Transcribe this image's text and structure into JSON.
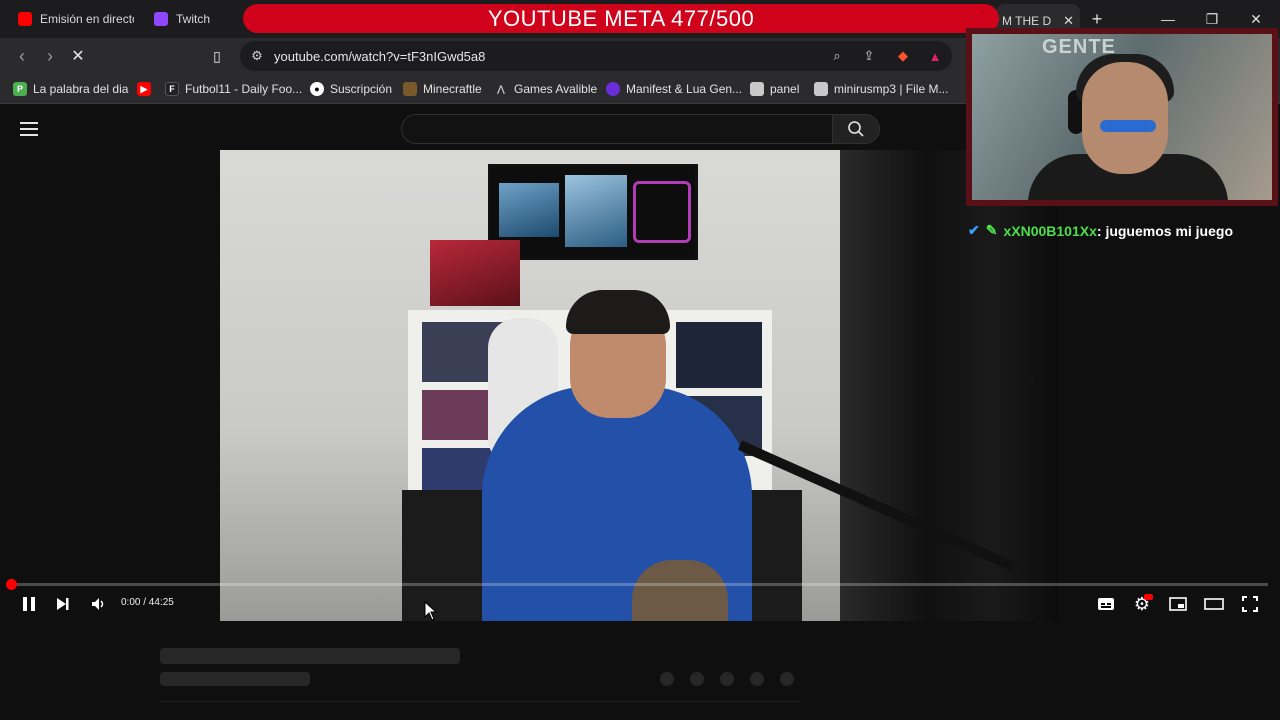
{
  "browser": {
    "tabs": [
      {
        "label": "Emisión en directo",
        "favicon": "youtube-icon",
        "color": "#ff0000"
      },
      {
        "label": "Twitch",
        "favicon": "twitch-icon",
        "color": "#9146ff"
      },
      {
        "label": "M THE D",
        "favicon": "",
        "active": true
      }
    ],
    "url": "youtube.com/watch?v=tF3nIGwd5a8",
    "window_controls": [
      "minimize-icon",
      "restore-icon",
      "close-icon"
    ]
  },
  "overlay": {
    "banner_text": "YOUTUBE META 477/500",
    "banner_color": "#d0021b"
  },
  "bookmarks": [
    {
      "label": "La palabra del dia",
      "icon": "p-icon",
      "color": "#4caf50"
    },
    {
      "label": "",
      "icon": "youtube-icon",
      "color": "#ff0000"
    },
    {
      "label": "Futbol11 - Daily Foo...",
      "icon": "futbol11-icon",
      "color": "#222222"
    },
    {
      "label": "Suscripción",
      "icon": "circle-icon",
      "color": "#ffffff"
    },
    {
      "label": "Minecraftle",
      "icon": "minecraft-icon",
      "color": "#7a5a2a"
    },
    {
      "label": "Games Avalible",
      "icon": "games-icon",
      "color": "#bbbbbb"
    },
    {
      "label": "Manifest & Lua Gen...",
      "icon": "manifest-icon",
      "color": "#6a2ed8"
    },
    {
      "label": "panel",
      "icon": "panel-icon",
      "color": "#c9c9c9"
    },
    {
      "label": "minirusmp3 | File M...",
      "icon": "file-icon",
      "color": "#c9c9c9"
    }
  ],
  "player": {
    "time": "0:00 / 44:25",
    "progress": 0.0,
    "state": "playing"
  },
  "chat": {
    "username": "xXN00B101Xx",
    "message": "juguemos mi juego",
    "badges": [
      "verified-icon",
      "moderator-icon"
    ]
  },
  "colors": {
    "yt_bg": "#0f0f0f",
    "progress": "#ff0000",
    "chat_user": "#4be04b"
  }
}
